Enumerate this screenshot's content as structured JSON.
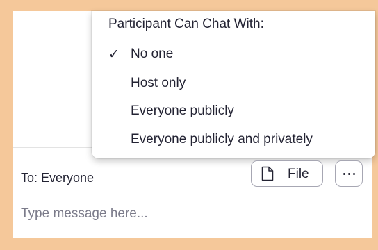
{
  "chat_permission_menu": {
    "title": "Participant Can Chat With:",
    "selected_mark": "✓",
    "items": [
      {
        "label": "No one",
        "selected": true
      },
      {
        "label": "Host only",
        "selected": false
      },
      {
        "label": "Everyone publicly",
        "selected": false
      },
      {
        "label": "Everyone publicly and privately",
        "selected": false
      }
    ]
  },
  "composer": {
    "recipient_label": "To: Everyone",
    "file_button_label": "File",
    "file_icon": "document-icon",
    "more_icon": "ellipsis-icon",
    "message_placeholder": "Type message here..."
  },
  "colors": {
    "frame_background": "#f5c89a",
    "text": "#232333",
    "placeholder": "#7b7b8a",
    "button_border": "#a7a7b3"
  }
}
